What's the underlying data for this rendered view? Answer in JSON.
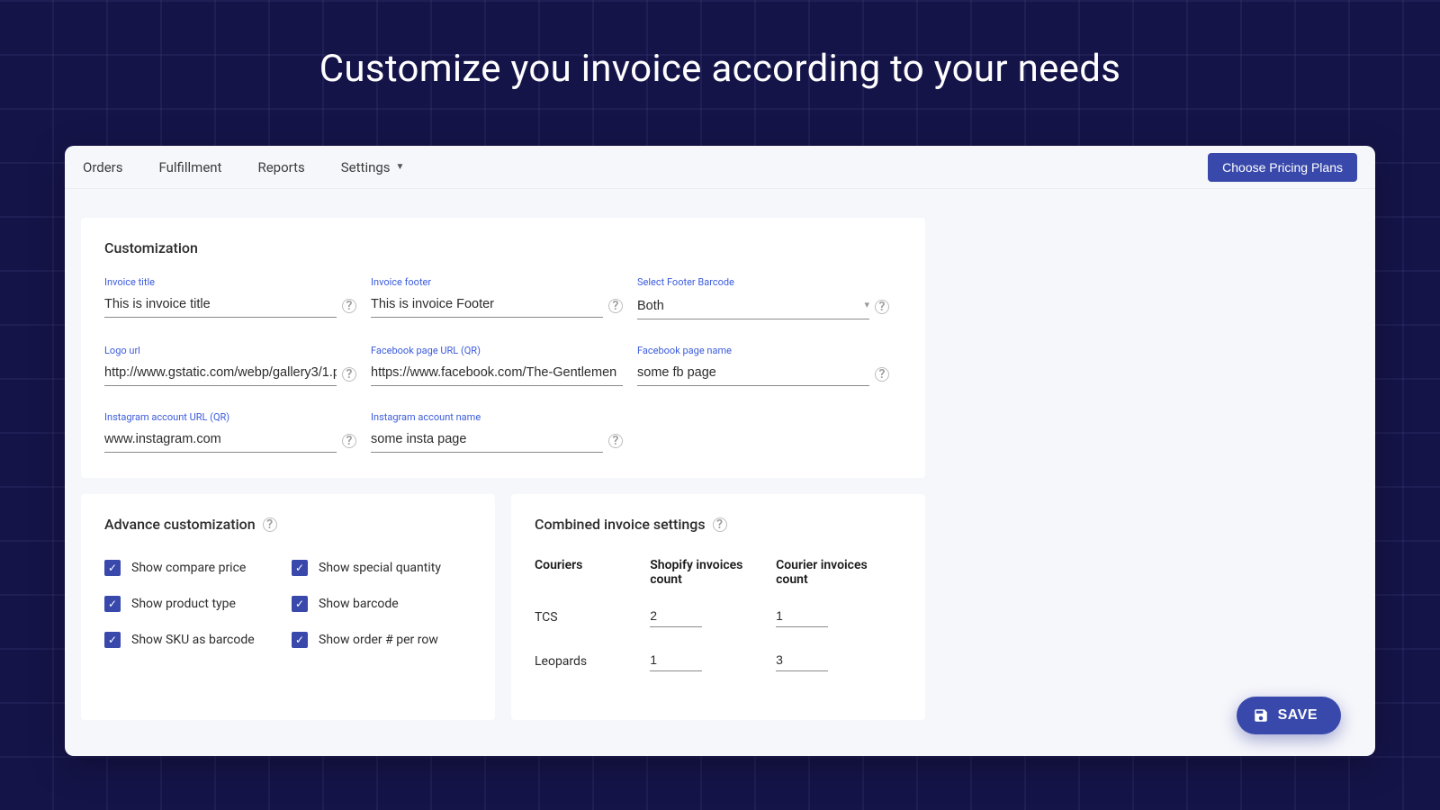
{
  "headline": "Customize you invoice according to your needs",
  "nav": {
    "orders": "Orders",
    "fulfillment": "Fulfillment",
    "reports": "Reports",
    "settings": "Settings"
  },
  "plansButton": "Choose Pricing Plans",
  "customization": {
    "title": "Customization",
    "fields": {
      "invoiceTitle": {
        "label": "Invoice title",
        "value": "This is invoice title"
      },
      "invoiceFooter": {
        "label": "Invoice footer",
        "value": "This is invoice Footer"
      },
      "footerBarcode": {
        "label": "Select Footer Barcode",
        "value": "Both"
      },
      "logoUrl": {
        "label": "Logo url",
        "value": "http://www.gstatic.com/webp/gallery3/1.p"
      },
      "fbPageUrl": {
        "label": "Facebook page URL (QR)",
        "value": "https://www.facebook.com/The-Gentlemen"
      },
      "fbPageName": {
        "label": "Facebook page name",
        "value": "some fb page"
      },
      "igUrl": {
        "label": "Instagram account URL (QR)",
        "value": "www.instagram.com"
      },
      "igName": {
        "label": "Instagram account name",
        "value": "some insta page"
      }
    }
  },
  "advance": {
    "title": "Advance customization",
    "checks": {
      "comparePrice": "Show compare price",
      "specialQty": "Show special quantity",
      "productType": "Show product type",
      "barcode": "Show barcode",
      "skuBarcode": "Show SKU as barcode",
      "orderPerRow": "Show order # per row"
    }
  },
  "combined": {
    "title": "Combined invoice settings",
    "headers": {
      "couriers": "Couriers",
      "shopify": "Shopify invoices count",
      "courier": "Courier invoices count"
    },
    "rows": [
      {
        "name": "TCS",
        "shopify": "2",
        "courier": "1"
      },
      {
        "name": "Leopards",
        "shopify": "1",
        "courier": "3"
      }
    ]
  },
  "saveButton": "SAVE"
}
